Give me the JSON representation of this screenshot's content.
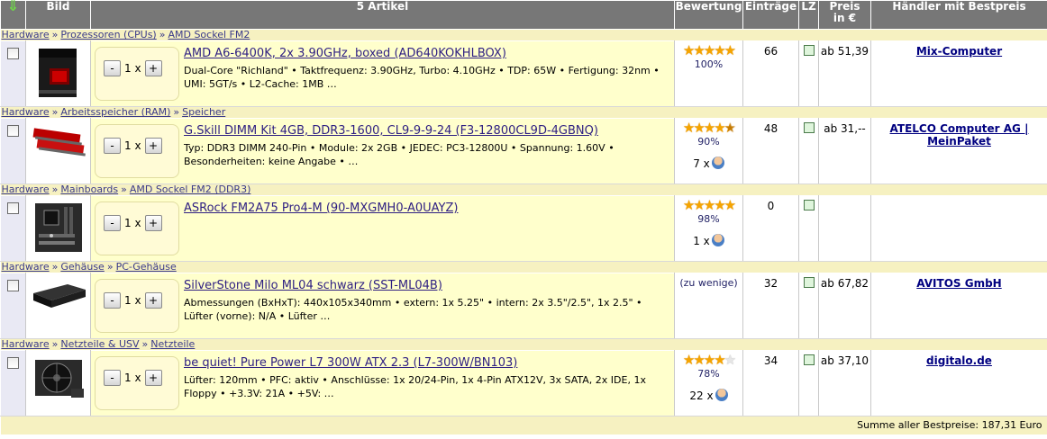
{
  "header": {
    "sort_icon": "arrow-down-icon",
    "col_image": "Bild",
    "col_articles": "5 Artikel",
    "col_rating": "Bewertung",
    "col_entries": "Einträge",
    "col_lz": "LZ",
    "col_price_l1": "Preis",
    "col_price_l2": "in €",
    "col_dealer": "Händler mit Bestpreis"
  },
  "products": [
    {
      "crumbs": [
        "Hardware",
        "Prozessoren (CPUs)",
        "AMD Sockel FM2"
      ],
      "qty": "1",
      "name": "AMD A6-6400K, 2x 3.90GHz, boxed (AD640KOKHLBOX)",
      "spec": "Dual-Core \"Richland\" • Taktfrequenz: 3.90GHz, Turbo: 4.10GHz • TDP: 65W • Fertigung: 32nm • UMI: 5GT/s • L2-Cache: 1MB …",
      "stars": 5,
      "rating_pct": "100%",
      "reviews": "",
      "entries": "66",
      "price": "ab 51,39",
      "dealer": "Mix-Computer",
      "thumb": "cpu-box"
    },
    {
      "crumbs": [
        "Hardware",
        "Arbeitsspeicher (RAM)",
        "Speicher"
      ],
      "qty": "1",
      "name": "G.Skill DIMM Kit 4GB, DDR3-1600, CL9-9-9-24 (F3-12800CL9D-4GBNQ)",
      "spec": "Typ: DDR3 DIMM 240-Pin • Module: 2x 2GB • JEDEC: PC3-12800U • Spannung: 1.60V • Besonderheiten: keine Angabe • …",
      "stars": 4.5,
      "rating_pct": "90%",
      "reviews": "7 x",
      "entries": "48",
      "price": "ab 31,--",
      "dealer": "ATELCO Computer AG | MeinPaket",
      "thumb": "ram"
    },
    {
      "crumbs": [
        "Hardware",
        "Mainboards",
        "AMD Sockel FM2 (DDR3)"
      ],
      "qty": "1",
      "name": "ASRock FM2A75 Pro4-M (90-MXGMH0-A0UAYZ)",
      "spec": "",
      "stars": 5,
      "rating_pct": "98%",
      "reviews": "1 x",
      "entries": "0",
      "price": "",
      "dealer": "",
      "thumb": "board"
    },
    {
      "crumbs": [
        "Hardware",
        "Gehäuse",
        "PC-Gehäuse"
      ],
      "qty": "1",
      "name": "SilverStone Milo ML04 schwarz (SST-ML04B)",
      "spec": "Abmessungen (BxHxT): 440x105x340mm • extern: 1x 5.25\" • intern: 2x 3.5\"/2.5\", 1x 2.5\" • Lüfter (vorne): N/A • Lüfter …",
      "stars": 0,
      "rating_pct": "(zu wenige)",
      "reviews": "",
      "entries": "32",
      "price": "ab 67,82",
      "dealer": "AVITOS GmbH",
      "thumb": "case"
    },
    {
      "crumbs": [
        "Hardware",
        "Netzteile & USV",
        "Netzteile"
      ],
      "qty": "1",
      "name": "be quiet! Pure Power L7 300W ATX 2.3 (L7-300W/BN103)",
      "spec": "Lüfter: 120mm • PFC: aktiv • Anschlüsse: 1x 20/24-Pin, 1x 4-Pin ATX12V, 3x SATA, 2x IDE, 1x Floppy • +3.3V: 21A • +5V: …",
      "stars": 4,
      "rating_pct": "78%",
      "reviews": "22 x",
      "entries": "34",
      "price": "ab 37,10",
      "dealer": "digitalo.de",
      "thumb": "psu"
    }
  ],
  "footer": {
    "total": "Summe aller Bestpreise: 187,31 Euro"
  },
  "colors": {
    "header_bg": "#777777",
    "crumb_bg": "#f6f1c1",
    "desc_bg": "#ffffcc",
    "link": "#2e1f82",
    "star": "#f5a400"
  }
}
